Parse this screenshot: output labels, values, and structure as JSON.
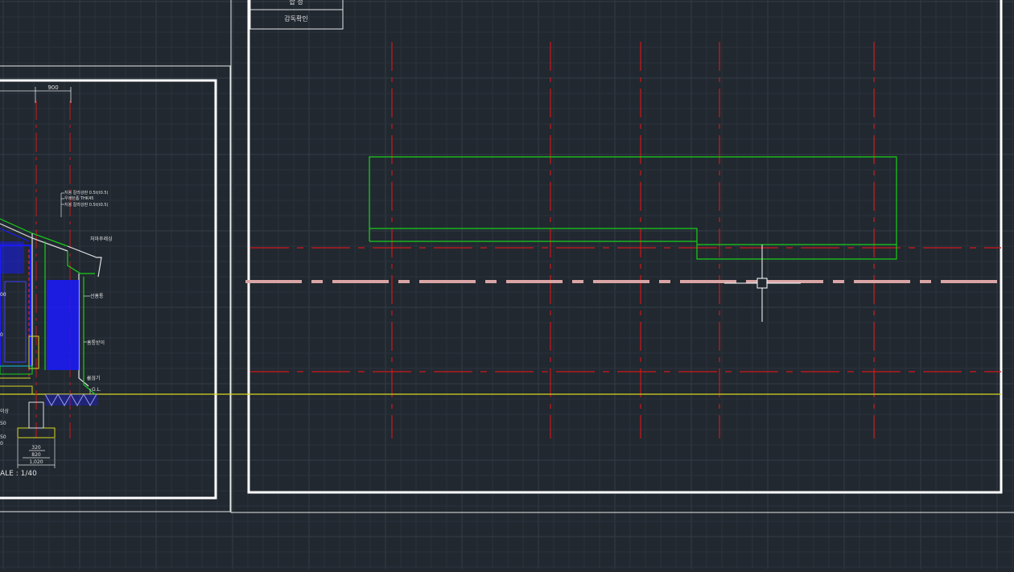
{
  "app": {
    "type": "CAD model space viewport",
    "colors": {
      "background": "#212830",
      "grid_minor": "#2a323b",
      "grid_major": "#333c46",
      "frame": "#ffffff",
      "centerline": "#d01818",
      "outline": "#18d018",
      "ground_line": "#d8d820",
      "section_blue": "#1a1aff",
      "highlight_line": "#d9a5a5",
      "crosshair": "#ffffff"
    }
  },
  "title_block": {
    "row_1": "합  정",
    "row_2": "감독확인"
  },
  "left_sheet": {
    "dimension_top": "900",
    "notes": [
      "지붕 칼라강판 0.5t(t0.5)",
      "우레탄폼 THK45",
      "지붕 칼라강판 0.5t(t0.5)"
    ],
    "callouts": {
      "eave_trim": "처마후레싱",
      "gutter": "선홈통",
      "downspout": "홈통받이",
      "sill": "물끊기",
      "ground_level": "G.L."
    },
    "partial_left_labels": [
      "00",
      "0",
      "이상",
      "50",
      "50",
      "0"
    ],
    "dimensions_bottom": [
      "320",
      "820",
      "1,020"
    ],
    "scale_label": "ALE : 1/40"
  },
  "cursor": {
    "type": "crosshair-pickbox"
  }
}
